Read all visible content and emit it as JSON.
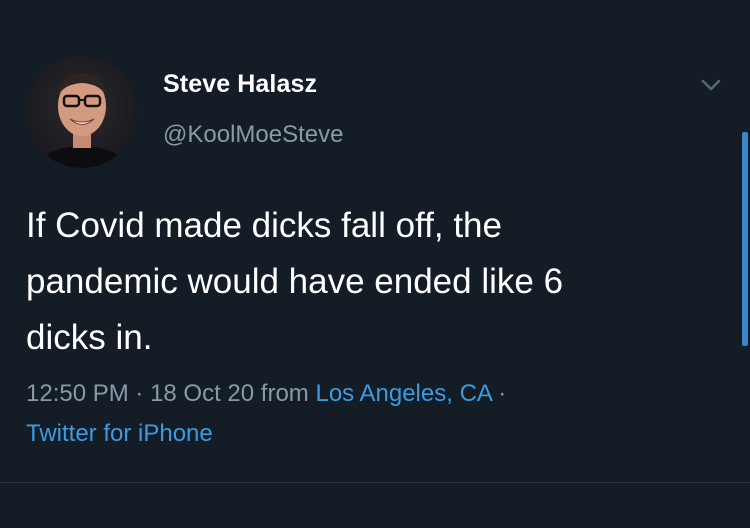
{
  "tweet": {
    "author": {
      "display_name": "Steve Halasz",
      "handle": "@KoolMoeSteve"
    },
    "text_lines": [
      "If Covid made dicks fall off, the",
      "pandemic would have ended like 6",
      "dicks in."
    ],
    "time": "12:50 PM",
    "separator": " · ",
    "date": "18 Oct 20",
    "from_label": " from ",
    "location": "Los Angeles, CA",
    "trailing_separator": " ·",
    "source": "Twitter for iPhone"
  },
  "icons": {
    "menu": "chevron-down-icon",
    "avatar": "profile-photo"
  },
  "colors": {
    "background": "#141c26",
    "primary_text": "#ffffff",
    "secondary_text": "#8b98a5",
    "link": "#3b9ae0"
  }
}
